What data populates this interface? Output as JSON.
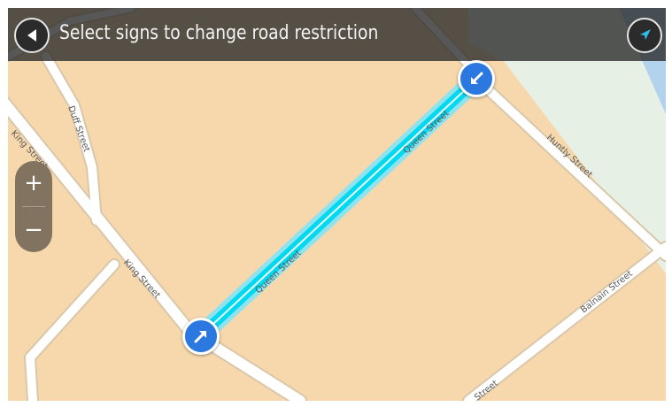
{
  "header": {
    "title": "Select signs to change road restriction",
    "back_icon": "back-arrow-icon",
    "nav_icon": "navigation-arrow-icon"
  },
  "zoom": {
    "in_label": "+",
    "out_label": "−"
  },
  "map": {
    "streets": {
      "queen_1": "Queen Street",
      "queen_2": "Queen Street",
      "king_1": "King Street",
      "king_2": "King Street",
      "duff": "Duff Street",
      "huntly": "Huntly Street",
      "balnain": "Balnain Street",
      "partial": "Street"
    },
    "selected_road": "Queen Street",
    "colors": {
      "land": "#f7d8ad",
      "road": "#ffffff",
      "water": "#b2d3ee",
      "park": "#e7f0e5",
      "selected_road": "#00d9f0",
      "marker": "#2a78e0"
    }
  },
  "markers": {
    "start_icon": "arrow-up-right-icon",
    "end_icon": "arrow-down-left-icon"
  }
}
